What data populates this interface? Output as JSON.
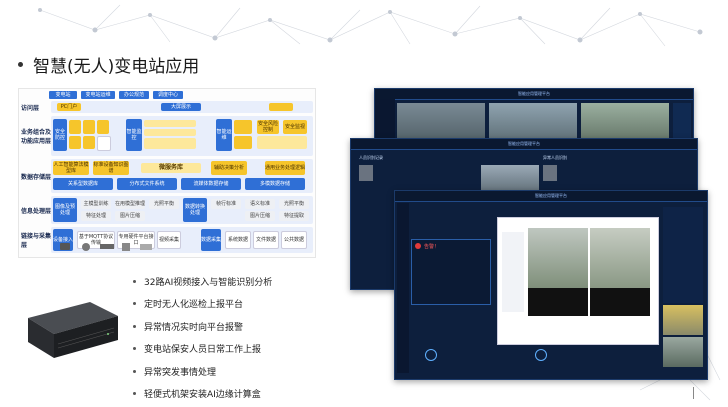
{
  "slide": {
    "title": "智慧(无人)变电站应用"
  },
  "architecture": {
    "top_tabs": [
      "变电站",
      "变电站运维",
      "办公规范",
      "调度中心"
    ],
    "layers": [
      {
        "label": "访问层",
        "blocks": [
          "PC门户",
          "大屏展示"
        ]
      },
      {
        "label": "业务组合及功能应用层",
        "blocks": [
          "安全防控",
          "智能监控",
          "智能运维",
          "安全风险控制",
          "安全监视"
        ]
      },
      {
        "label": "数据存储层",
        "blocks": [
          "人工智能算法模型库",
          "标准设备知识图谱",
          "微服务库",
          "辅助决策分析",
          "通用业务处理逻辑",
          "关系型数据库",
          "分布式文件系统",
          "流媒体数据存储",
          "多模数据存储"
        ]
      },
      {
        "label": "信息处理层",
        "blocks": [
          "图像及预处理",
          "主模型训练",
          "在用模型推理",
          "光照平衡",
          "数据转换处理",
          "帧行标准",
          "语义标准",
          "光照平衡",
          "特征处理",
          "图片压缩",
          "图片压缩",
          "特征提取"
        ]
      },
      {
        "label": "链接与采集层",
        "blocks": [
          "设备接入",
          "基于MQTT协议传输",
          "专用硬件平台接口",
          "视频采集",
          "数据采集",
          "系统数据",
          "文件数据",
          "公共数据"
        ]
      }
    ]
  },
  "features": [
    "32路AI视频接入与智能识别分析",
    "定时无人化巡检上报平台",
    "异常情况实时向平台报警",
    "变电站保安人员日常工作上报",
    "异常突发事情处理",
    "轻便式机架安装AI边缘计算盒"
  ],
  "screens": {
    "screen1_title": "智能应用管理平台",
    "screen2_title": "智能应用管理平台",
    "screen2_panel_left": "人员识别记录",
    "screen2_panel_right": "异常人员识别",
    "screen3_title": "智能应用管理平台",
    "alert_title": "告警！"
  },
  "colors": {
    "accent_blue": "#2f6fd6",
    "accent_yellow": "#f6c52b",
    "screen_bg": "#0d1f3d"
  }
}
